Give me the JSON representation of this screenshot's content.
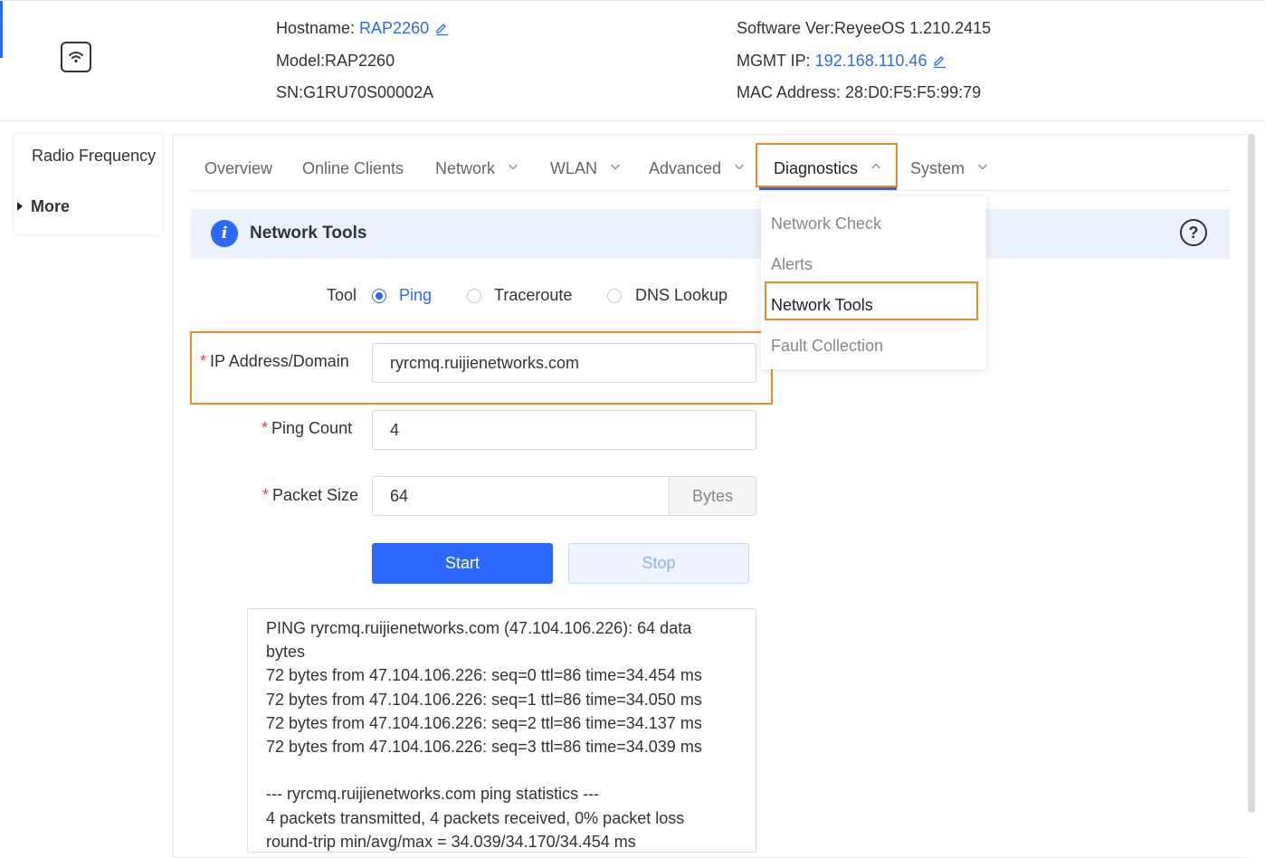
{
  "header": {
    "hostname_label": "Hostname: ",
    "hostname_value": "RAP2260",
    "model": "Model:RAP2260",
    "sn": "SN:G1RU70S00002A",
    "software": "Software Ver:ReyeeOS 1.210.2415",
    "mgmt_ip_label": "MGMT IP: ",
    "mgmt_ip_value": "192.168.110.46",
    "mac": "MAC Address: 28:D0:F5:F5:99:79",
    "device_icon": "wifi-icon"
  },
  "left_menu": {
    "items": [
      "Radio Frequency",
      "More"
    ]
  },
  "tabs": [
    {
      "label": "Overview",
      "dropdown": false
    },
    {
      "label": "Online Clients",
      "dropdown": false
    },
    {
      "label": "Network",
      "dropdown": true
    },
    {
      "label": "WLAN",
      "dropdown": true
    },
    {
      "label": "Advanced",
      "dropdown": true
    },
    {
      "label": "Diagnostics",
      "dropdown": true,
      "active": true
    },
    {
      "label": "System",
      "dropdown": true
    }
  ],
  "diagnostics_menu": {
    "items": [
      "Network Check",
      "Alerts",
      "Network Tools",
      "Fault Collection"
    ],
    "selected": "Network Tools"
  },
  "section": {
    "title": "Network Tools",
    "info_icon": "info-icon",
    "help_icon": "help-icon"
  },
  "form": {
    "tool_label": "Tool",
    "tools": [
      "Ping",
      "Traceroute",
      "DNS Lookup"
    ],
    "selected_tool": "Ping",
    "required_mark": "*",
    "ip_label": "IP Address/Domain",
    "ip_value": "ryrcmq.ruijienetworks.com",
    "count_label": "Ping Count",
    "count_value": "4",
    "size_label": "Packet Size",
    "size_value": "64",
    "size_unit": "Bytes",
    "start_label": "Start",
    "stop_label": "Stop"
  },
  "output_lines": [
    "PING ryrcmq.ruijienetworks.com (47.104.106.226): 64 data",
    "bytes",
    "72 bytes from 47.104.106.226: seq=0 ttl=86 time=34.454 ms",
    "72 bytes from 47.104.106.226: seq=1 ttl=86 time=34.050 ms",
    "72 bytes from 47.104.106.226: seq=2 ttl=86 time=34.137 ms",
    "72 bytes from 47.104.106.226: seq=3 ttl=86 time=34.039 ms",
    "",
    "--- ryrcmq.ruijienetworks.com ping statistics ---",
    "4 packets transmitted, 4 packets received, 0% packet loss",
    "round-trip min/avg/max = 34.039/34.170/34.454 ms"
  ],
  "colors": {
    "accent": "#2c68ff",
    "highlight": "#f08a24",
    "required": "#e54545"
  }
}
